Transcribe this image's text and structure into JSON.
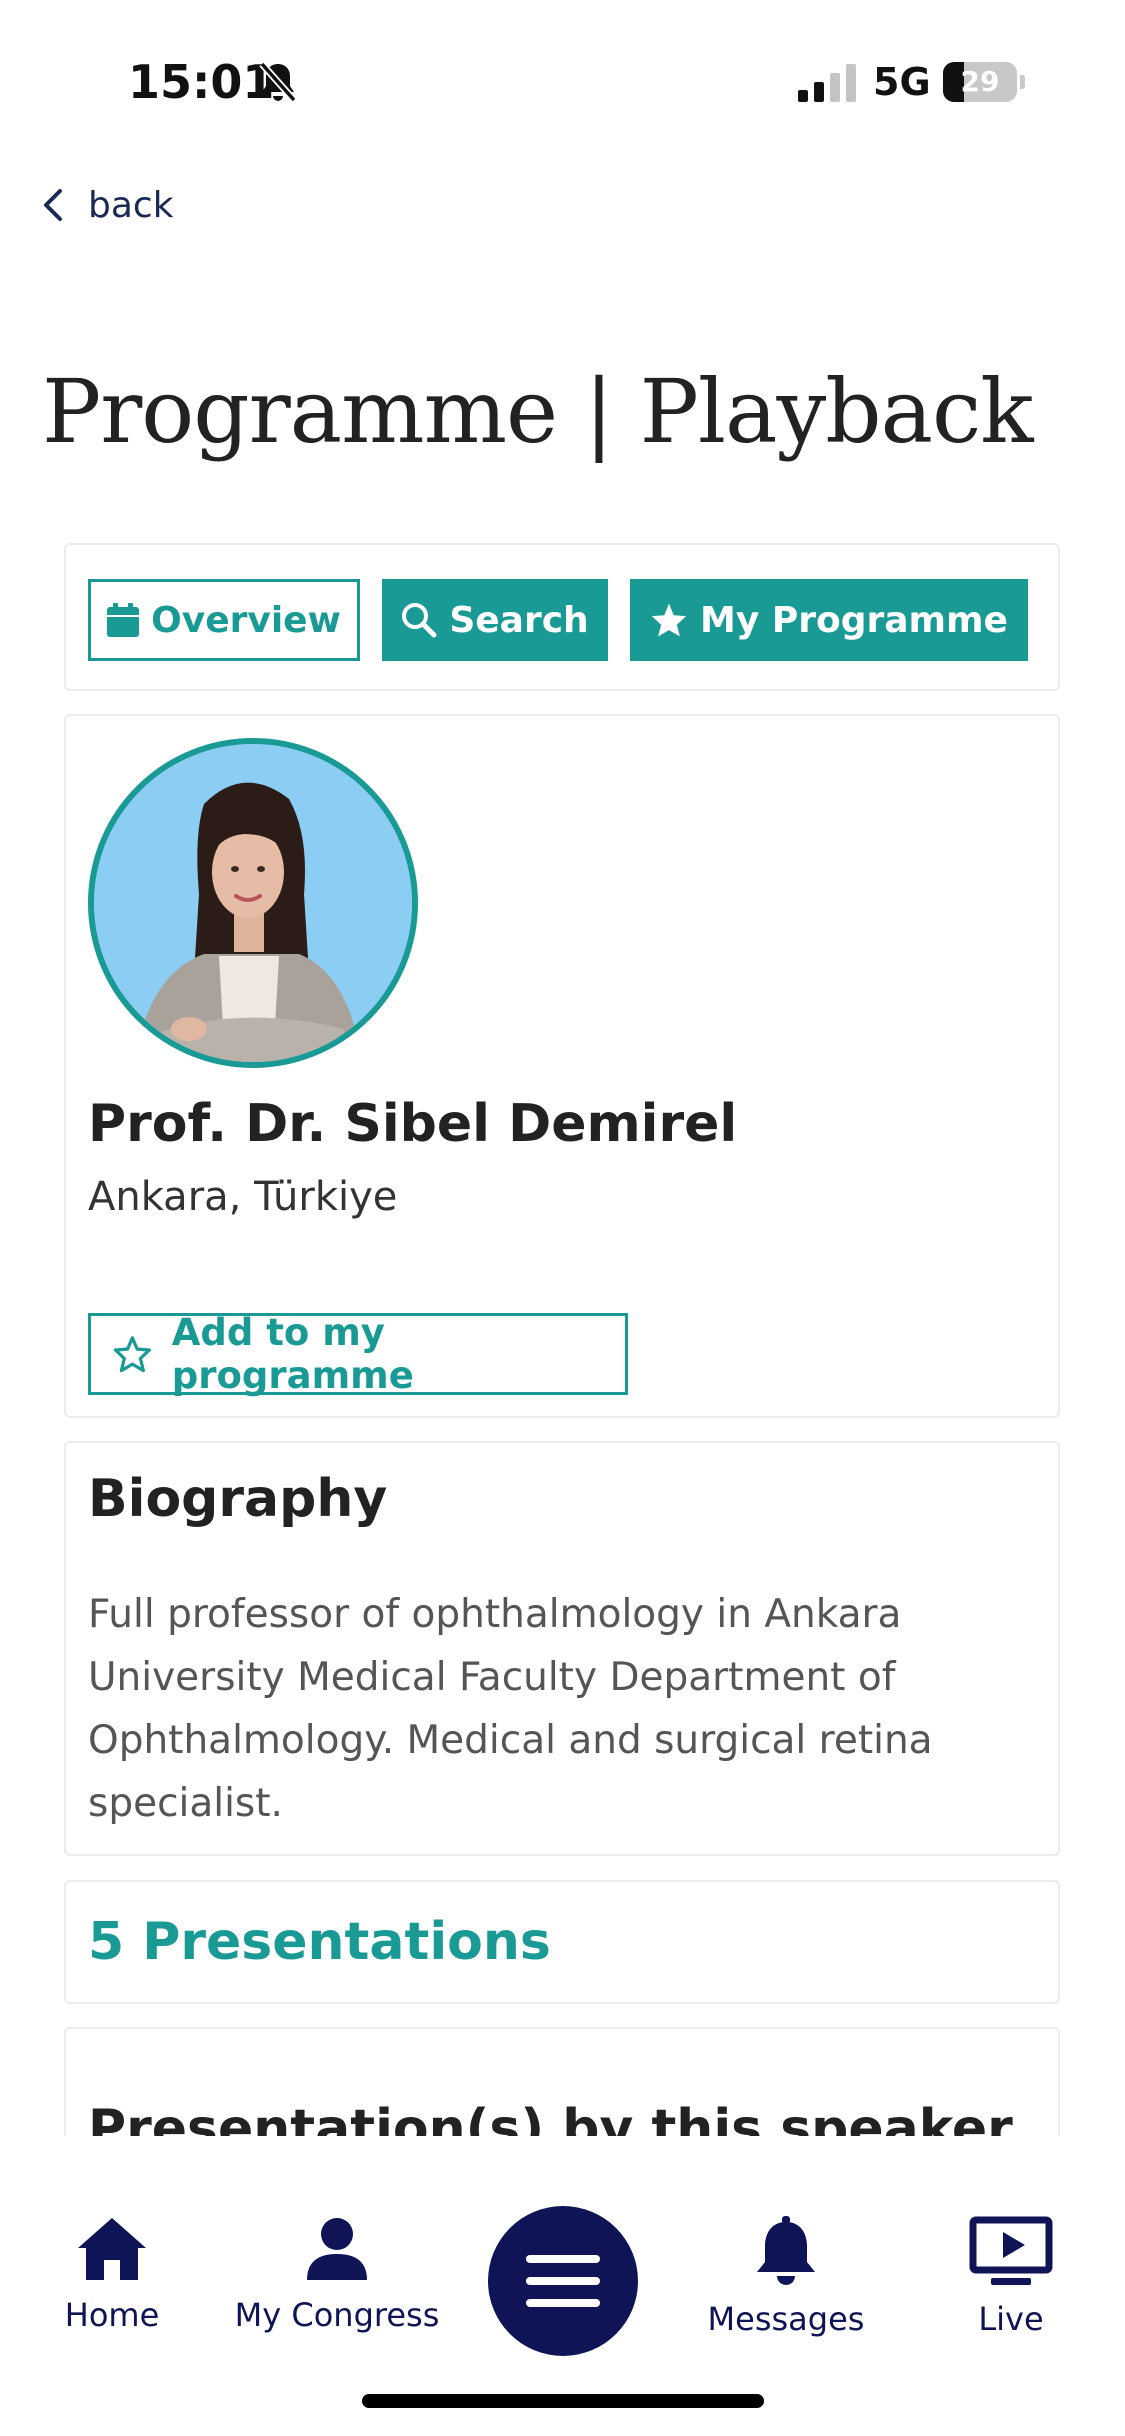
{
  "status_bar": {
    "time": "15:01",
    "network": "5G",
    "battery": "29",
    "battery_level": 0.29
  },
  "nav": {
    "back_label": "back"
  },
  "page": {
    "title": "Programme | Playback"
  },
  "toolbar": {
    "overview_label": "Overview",
    "search_label": "Search",
    "my_programme_label": "My Programme"
  },
  "speaker": {
    "name": "Prof. Dr. Sibel Demirel",
    "location": "Ankara, Türkiye",
    "add_label": "Add to my programme"
  },
  "biography": {
    "title": "Biography",
    "text": "Full professor of ophthalmology in Ankara University Medical Faculty Department of Ophthalmology. Medical and surgical retina specialist."
  },
  "presentations": {
    "count_label": "5 Presentations",
    "list_title": "Presentation(s) by this speaker"
  },
  "bottom_nav": {
    "home": "Home",
    "my_congress": "My Congress",
    "messages": "Messages",
    "live": "Live"
  },
  "colors": {
    "accent": "#1a9a94",
    "nav": "#0f1456"
  }
}
